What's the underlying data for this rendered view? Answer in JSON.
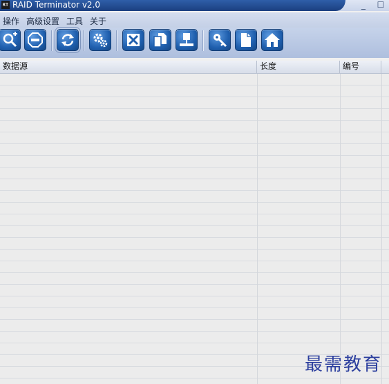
{
  "window": {
    "title": "RAID Terminator v2.0",
    "icon_text": "RT",
    "minimize_glyph": "_",
    "maximize_glyph": "☐"
  },
  "menu": [
    "操作",
    "高级设置",
    "工具",
    "关于"
  ],
  "toolbar": {
    "buttons": [
      {
        "name": "search-add",
        "icon": "magnifier-plus-icon"
      },
      {
        "name": "stop",
        "icon": "stop-sign-icon"
      },
      {
        "name": "refresh",
        "icon": "refresh-arrows-icon"
      },
      {
        "name": "settings",
        "icon": "gears-icon"
      },
      {
        "name": "delete",
        "icon": "x-box-icon"
      },
      {
        "name": "copy",
        "icon": "copy-pages-icon"
      },
      {
        "name": "network",
        "icon": "monitor-network-icon"
      },
      {
        "name": "key",
        "icon": "key-icon"
      },
      {
        "name": "document",
        "icon": "document-icon"
      },
      {
        "name": "home",
        "icon": "home-icon"
      }
    ]
  },
  "table": {
    "columns": [
      "数据源",
      "长度",
      "编号"
    ],
    "rows": []
  },
  "watermark": "最需教育",
  "colors": {
    "title_bar": "#1b3f80",
    "toolbar_button": "#1f5fae",
    "watermark": "#2c3f9e"
  }
}
